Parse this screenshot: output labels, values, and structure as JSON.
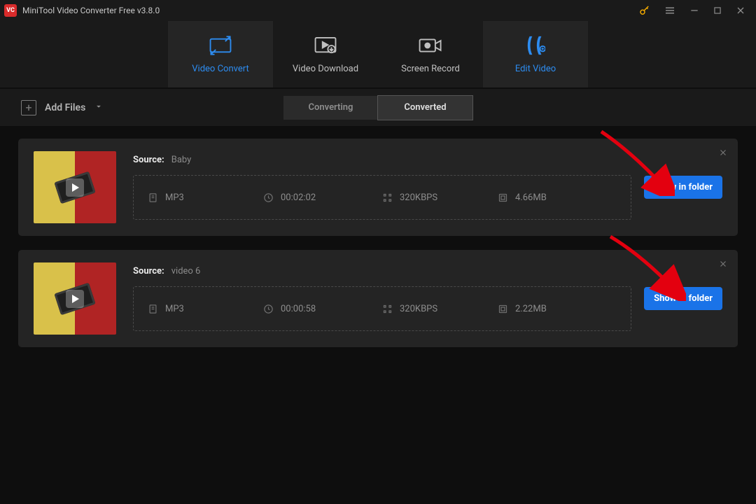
{
  "title": "MiniTool Video Converter Free v3.8.0",
  "main_tabs": {
    "convert": "Video Convert",
    "download": "Video Download",
    "record": "Screen Record",
    "edit": "Edit Video"
  },
  "sec_bar": {
    "add_files": "Add Files",
    "converting": "Converting",
    "converted": "Converted"
  },
  "common": {
    "source_label": "Source:",
    "show_btn": "Show in folder"
  },
  "items": [
    {
      "source": "Baby",
      "format": "MP3",
      "duration": "00:02:02",
      "bitrate": "320KBPS",
      "size": "4.66MB"
    },
    {
      "source": "video 6",
      "format": "MP3",
      "duration": "00:00:58",
      "bitrate": "320KBPS",
      "size": "2.22MB"
    }
  ]
}
